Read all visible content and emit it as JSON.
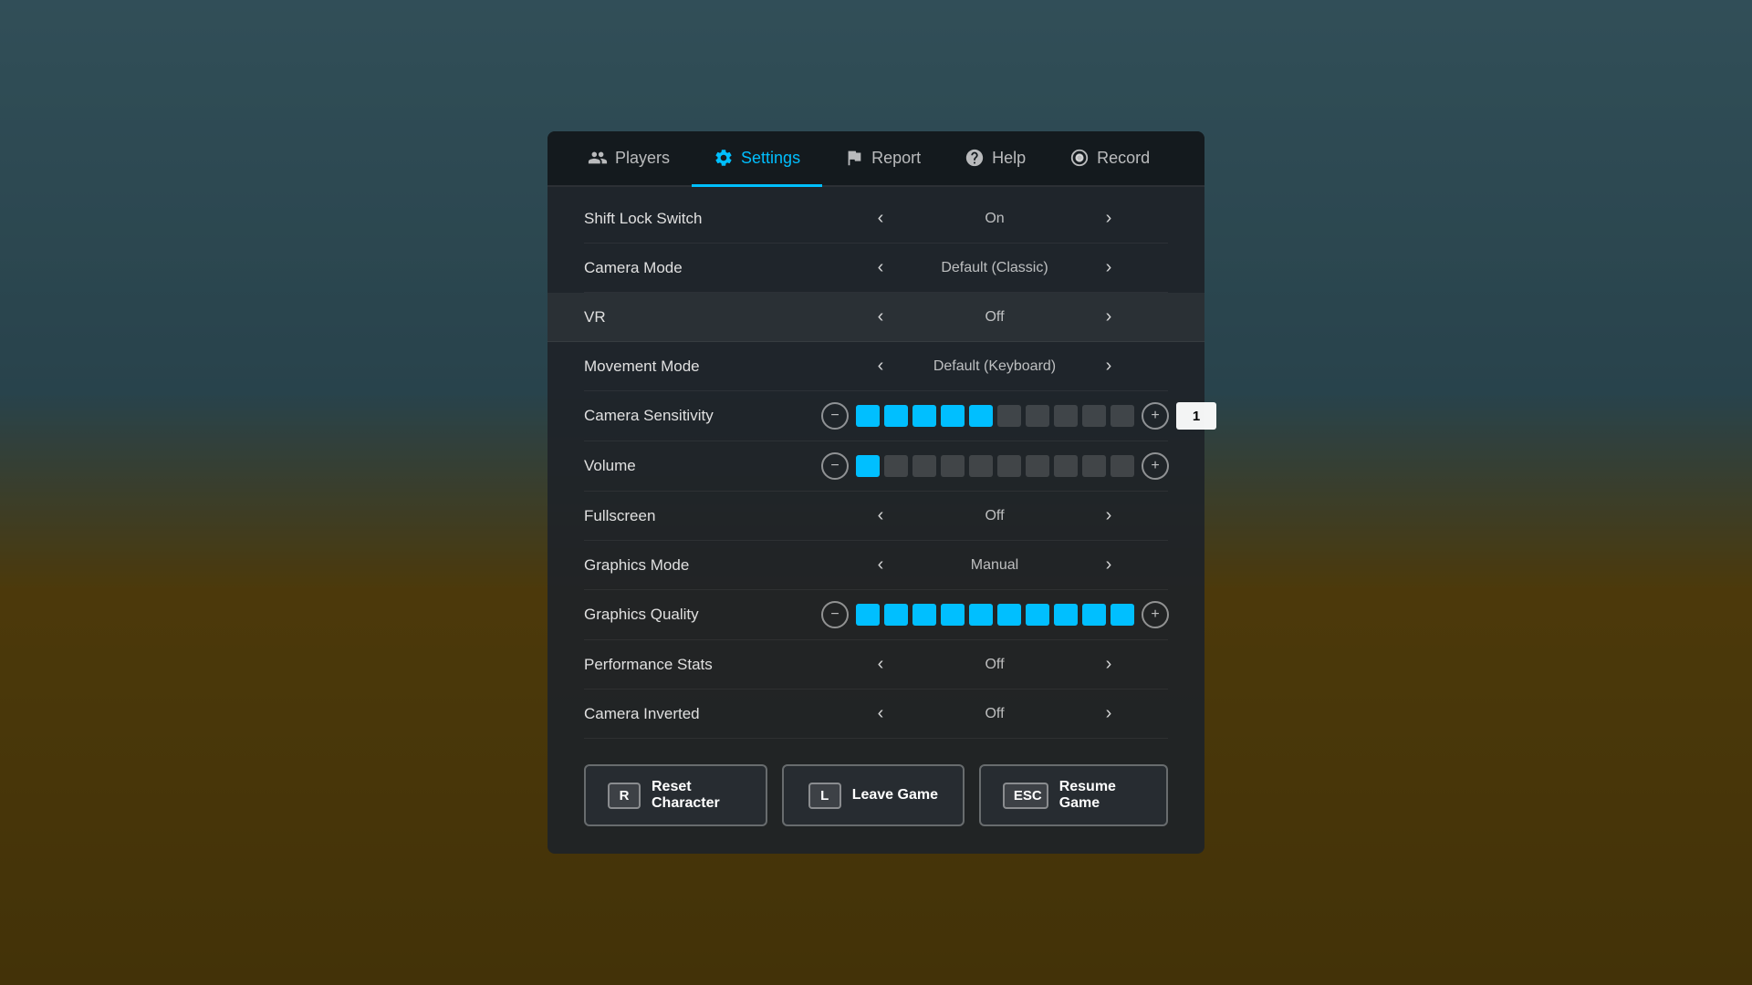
{
  "tabs": [
    {
      "id": "players",
      "label": "Players",
      "icon": "👥",
      "active": false
    },
    {
      "id": "settings",
      "label": "Settings",
      "icon": "⚙️",
      "active": true
    },
    {
      "id": "report",
      "label": "Report",
      "icon": "🚩",
      "active": false
    },
    {
      "id": "help",
      "label": "Help",
      "icon": "❓",
      "active": false
    },
    {
      "id": "record",
      "label": "Record",
      "icon": "◎",
      "active": false
    }
  ],
  "settings": [
    {
      "id": "shift-lock",
      "label": "Shift Lock Switch",
      "type": "toggle",
      "value": "On",
      "highlighted": false
    },
    {
      "id": "camera-mode",
      "label": "Camera Mode",
      "type": "toggle",
      "value": "Default (Classic)",
      "highlighted": false
    },
    {
      "id": "vr",
      "label": "VR",
      "type": "toggle",
      "value": "Off",
      "highlighted": true
    },
    {
      "id": "movement-mode",
      "label": "Movement Mode",
      "type": "toggle",
      "value": "Default (Keyboard)",
      "highlighted": false
    },
    {
      "id": "camera-sensitivity",
      "label": "Camera Sensitivity",
      "type": "slider",
      "filledBars": 5,
      "totalBars": 10,
      "inputValue": "1",
      "highlighted": false
    },
    {
      "id": "volume",
      "label": "Volume",
      "type": "slider",
      "filledBars": 1,
      "totalBars": 10,
      "inputValue": null,
      "highlighted": false
    },
    {
      "id": "fullscreen",
      "label": "Fullscreen",
      "type": "toggle",
      "value": "Off",
      "highlighted": false
    },
    {
      "id": "graphics-mode",
      "label": "Graphics Mode",
      "type": "toggle",
      "value": "Manual",
      "highlighted": false
    },
    {
      "id": "graphics-quality",
      "label": "Graphics Quality",
      "type": "slider",
      "filledBars": 10,
      "totalBars": 10,
      "inputValue": null,
      "highlighted": false
    },
    {
      "id": "performance-stats",
      "label": "Performance Stats",
      "type": "toggle",
      "value": "Off",
      "highlighted": false
    },
    {
      "id": "camera-inverted",
      "label": "Camera Inverted",
      "type": "toggle",
      "value": "Off",
      "highlighted": false
    }
  ],
  "buttons": [
    {
      "id": "reset",
      "key": "R",
      "label": "Reset Character"
    },
    {
      "id": "leave",
      "key": "L",
      "label": "Leave Game"
    },
    {
      "id": "resume",
      "key": "ESC",
      "label": "Resume Game"
    }
  ],
  "colors": {
    "accent": "#00bfff",
    "filled_bar": "#00bfff",
    "empty_bar": "rgba(255,255,255,0.15)"
  }
}
